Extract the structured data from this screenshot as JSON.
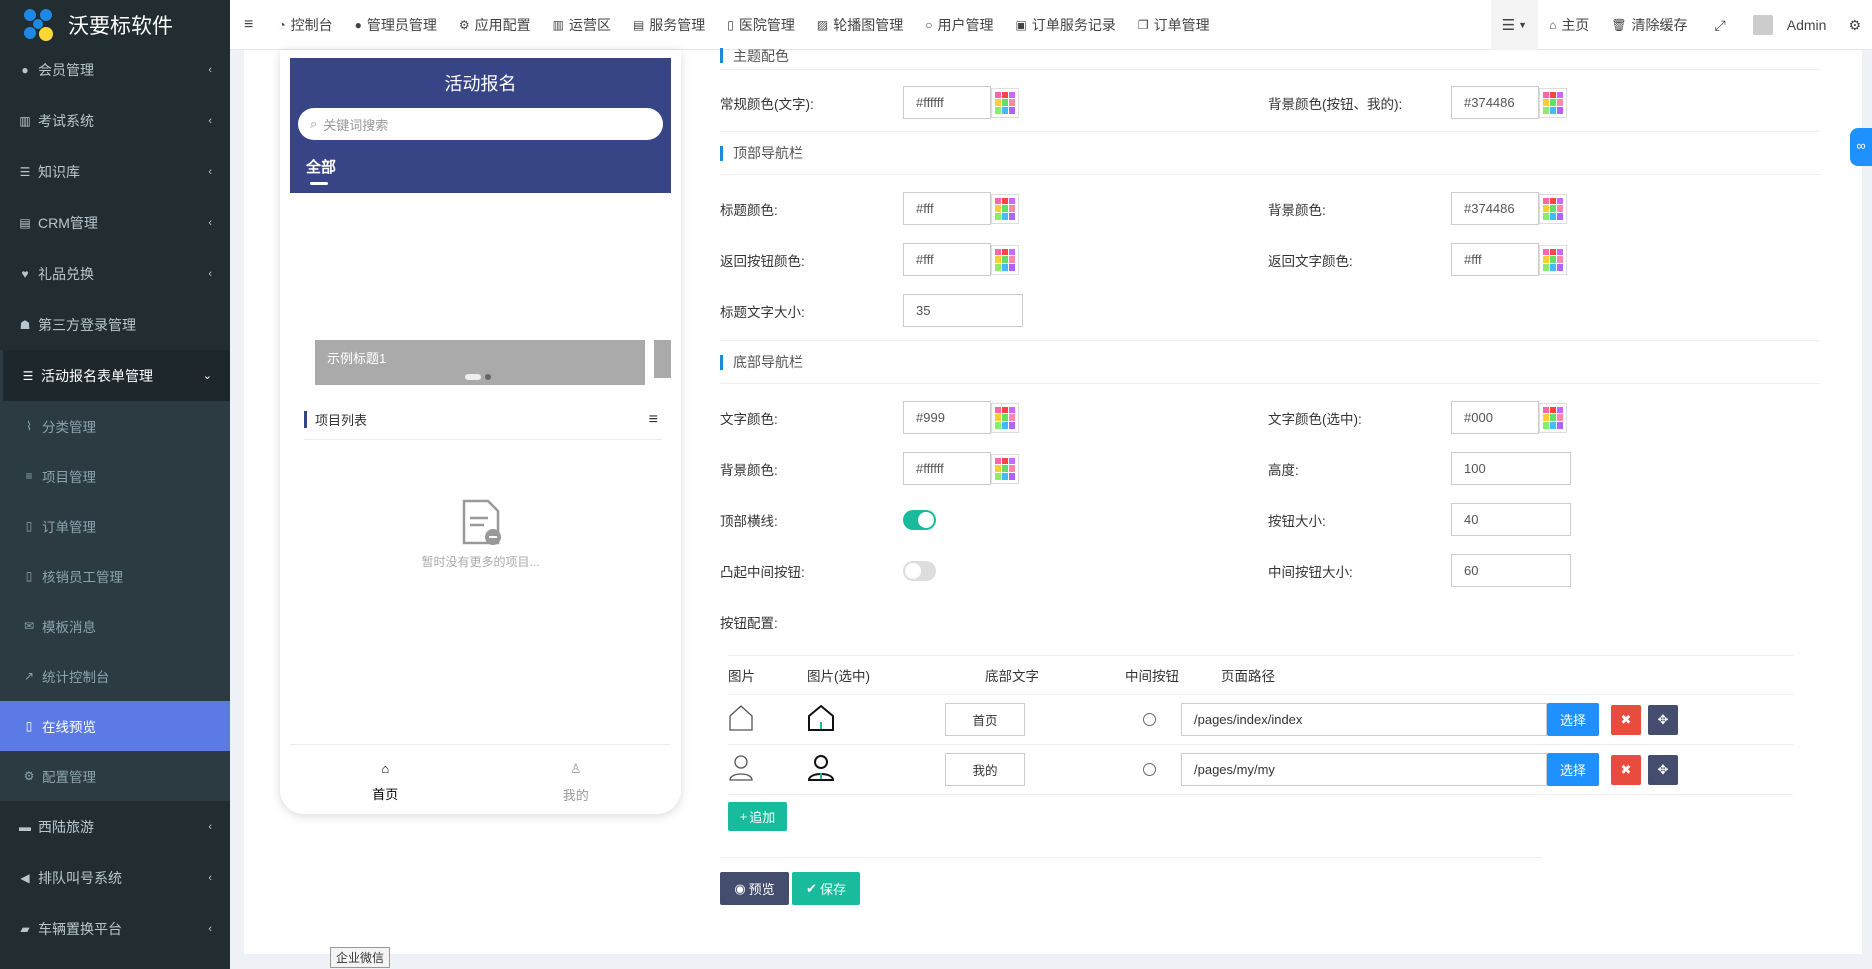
{
  "app": {
    "title": "沃要标软件"
  },
  "sidebar": {
    "items": [
      {
        "label": "会员管理",
        "icon": "user-circle-icon"
      },
      {
        "label": "考试系统",
        "icon": "columns-icon"
      },
      {
        "label": "知识库",
        "icon": "list-icon"
      },
      {
        "label": "CRM管理",
        "icon": "id-card-icon"
      },
      {
        "label": "礼品兑换",
        "icon": "heart-icon"
      },
      {
        "label": "第三方登录管理",
        "icon": "users-icon"
      },
      {
        "label": "活动报名表单管理",
        "icon": "list-icon"
      }
    ],
    "sub_items": [
      {
        "label": "分类管理",
        "icon": "cart-icon"
      },
      {
        "label": "项目管理",
        "icon": "bars-icon"
      },
      {
        "label": "订单管理",
        "icon": "file-icon"
      },
      {
        "label": "核销员工管理",
        "icon": "file-icon"
      },
      {
        "label": "模板消息",
        "icon": "envelope-icon"
      },
      {
        "label": "统计控制台",
        "icon": "chart-line-icon"
      },
      {
        "label": "在线预览",
        "icon": "mobile-icon"
      },
      {
        "label": "配置管理",
        "icon": "cogs-icon"
      }
    ],
    "bottom_items": [
      {
        "label": "西陆旅游",
        "icon": "folder-icon"
      },
      {
        "label": "排队叫号系统",
        "icon": "bullhorn-icon"
      },
      {
        "label": "车辆置换平台",
        "icon": "car-icon"
      }
    ]
  },
  "topnav": {
    "items": [
      {
        "label": "控制台",
        "icon": "dashboard-icon"
      },
      {
        "label": "管理员管理",
        "icon": "user-icon"
      },
      {
        "label": "应用配置",
        "icon": "gear-icon"
      },
      {
        "label": "运营区",
        "icon": "map-icon"
      },
      {
        "label": "服务管理",
        "icon": "list-alt-icon"
      },
      {
        "label": "医院管理",
        "icon": "clipboard-icon"
      },
      {
        "label": "轮播图管理",
        "icon": "image-icon"
      },
      {
        "label": "用户管理",
        "icon": "user-outline-icon"
      },
      {
        "label": "订单服务记录",
        "icon": "save-icon"
      },
      {
        "label": "订单管理",
        "icon": "copy-icon"
      }
    ],
    "home": "主页",
    "clear_cache": "清除缓存",
    "admin": "Admin"
  },
  "phone": {
    "title": "活动报名",
    "search_placeholder": "关键词搜索",
    "tab": "全部",
    "banner_title": "示例标题1",
    "list_title": "项目列表",
    "empty_text": "暂时没有更多的项目...",
    "footer": {
      "home": "首页",
      "mine": "我的"
    }
  },
  "form": {
    "theme_section": "主题配色",
    "normal_color_label": "常规颜色(文字):",
    "normal_color": "#ffffff",
    "bg_color_label": "背景颜色(按钮、我的):",
    "bg_color": "#374486",
    "top_nav_section": "顶部导航栏",
    "title_color_label": "标题颜色:",
    "title_color": "#fff",
    "top_bg_label": "背景颜色:",
    "top_bg": "#374486",
    "back_btn_label": "返回按钮颜色:",
    "back_btn": "#fff",
    "back_text_label": "返回文字颜色:",
    "back_text": "#fff",
    "title_size_label": "标题文字大小:",
    "title_size": "35",
    "bottom_nav_section": "底部导航栏",
    "text_color_label": "文字颜色:",
    "text_color": "#999",
    "text_sel_label": "文字颜色(选中):",
    "text_sel": "#000",
    "bottom_bg_label": "背景颜色:",
    "bottom_bg": "#ffffff",
    "height_label": "高度:",
    "height": "100",
    "top_line_label": "顶部横线:",
    "top_line_on": true,
    "btn_size_label": "按钮大小:",
    "btn_size": "40",
    "mid_btn_label": "凸起中间按钮:",
    "mid_btn_on": false,
    "mid_btn_size_label": "中间按钮大小:",
    "mid_btn_size": "60",
    "btn_config_label": "按钮配置:",
    "table_headers": [
      "图片",
      "图片(选中)",
      "底部文字",
      "中间按钮",
      "页面路径"
    ],
    "rows": [
      {
        "text": "首页",
        "path": "/pages/index/index"
      },
      {
        "text": "我的",
        "path": "/pages/my/my"
      }
    ],
    "select_label": "选择",
    "add_label": "追加",
    "preview_label": "预览",
    "save_label": "保存"
  },
  "tooltip": "企业微信",
  "colors": {
    "accent": "#374486",
    "sidebar": "#222d32",
    "active": "#5c7ae6",
    "green": "#18bc9c",
    "blue": "#1e90ff",
    "red": "#e74c3c"
  }
}
